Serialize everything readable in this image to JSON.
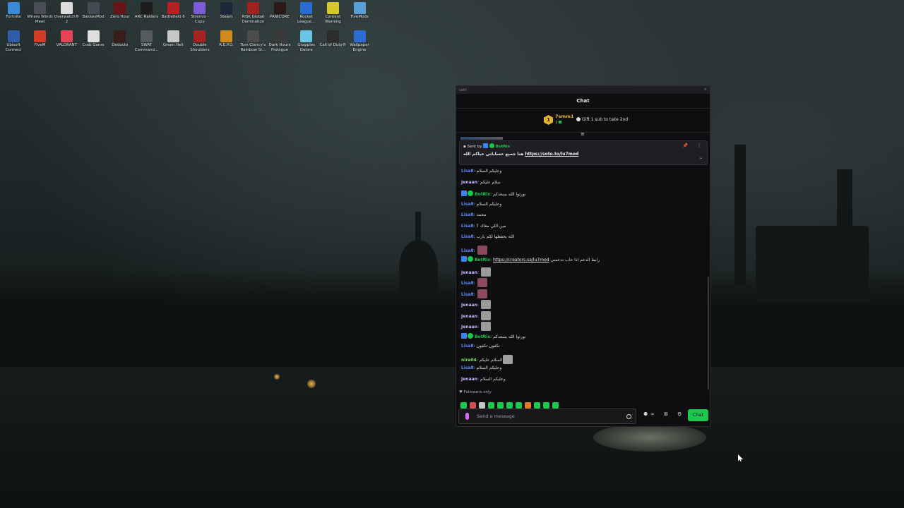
{
  "desktop": {
    "icons_row1": [
      {
        "label": "Fortnite",
        "color": "#3b8ad8"
      },
      {
        "label": "Where Winds Meet",
        "color": "#4a4f55"
      },
      {
        "label": "Overwatch® 2",
        "color": "#dcdcdc"
      },
      {
        "label": "BakkesMod",
        "color": "#444a52"
      },
      {
        "label": "Zero Hour",
        "color": "#6a1515"
      },
      {
        "label": "ARC Raiders",
        "color": "#1c1c1c"
      },
      {
        "label": "Battlefield 6",
        "color": "#b81f25"
      },
      {
        "label": "Stremio - Copy",
        "color": "#7b5bd6"
      },
      {
        "label": "Steam",
        "color": "#1b2838"
      },
      {
        "label": "RISK Global Domination",
        "color": "#a32020"
      },
      {
        "label": "PANICORE",
        "color": "#2a1a1a"
      },
      {
        "label": "Rocket League...",
        "color": "#2a6bd1"
      },
      {
        "label": "Content Warning",
        "color": "#d7c62e"
      },
      {
        "label": "FiveMods",
        "color": "#5aa0d6"
      }
    ],
    "icons_row2": [
      {
        "label": "Ubisoft Connect",
        "color": "#2f5da8"
      },
      {
        "label": "FiveM",
        "color": "#d43c24"
      },
      {
        "label": "VALORANT",
        "color": "#e84455"
      },
      {
        "label": "Crab Game",
        "color": "#dedede"
      },
      {
        "label": "Deducto",
        "color": "#3a1c1c"
      },
      {
        "label": "SWAT Command...",
        "color": "#555a60"
      },
      {
        "label": "Green Hell",
        "color": "#c7c7c7"
      },
      {
        "label": "Double Shoulders",
        "color": "#a92222"
      },
      {
        "label": "R.E.P.O.",
        "color": "#d08a1e"
      },
      {
        "label": "Tom Clancy's Rainbow Si...",
        "color": "#4d4d4d"
      },
      {
        "label": "Dark Hours Prologue",
        "color": "#3a3a3a"
      },
      {
        "label": "Grapples Galore",
        "color": "#6ac2e5"
      },
      {
        "label": "Call of Duty®",
        "color": "#2c2c2c"
      },
      {
        "label": "Wallpaper Engine",
        "color": "#2d6ad1"
      }
    ]
  },
  "chat_window": {
    "title": "cah!",
    "close": "×",
    "header": "Chat",
    "leader": {
      "rank": "1",
      "username": "7smm1",
      "count": "1",
      "gift_text": "Gift 1 sub to take 2nd"
    },
    "collapse_icon": "≡",
    "pinned": {
      "sent_by": "Sent by",
      "bot_name": "BotRix",
      "message": "هنا جميع حساباتي حياكم الله",
      "link": "https://soto.to/lu7mod",
      "pin_icon": "📌",
      "more_icon": "⋮",
      "expand_icon": "⌄"
    },
    "messages": [
      {
        "user": "Lisa8",
        "text": "وعليكم السلام",
        "cls": "u-lisa",
        "badges": false,
        "emotes": 0,
        "link": ""
      },
      {
        "user": "Jenaan",
        "text": "سلام عليكم",
        "cls": "u-jen",
        "badges": false,
        "emotes": 0,
        "link": ""
      },
      {
        "user": "BotRix",
        "text": "نورتوا الله يسعدكم",
        "cls": "u-bot",
        "badges": true,
        "emotes": 0,
        "link": ""
      },
      {
        "user": "Lisa8",
        "text": "وعليكم السلام",
        "cls": "u-lisa",
        "badges": false,
        "emotes": 0,
        "link": ""
      },
      {
        "user": "Lisa8",
        "text": "محمد",
        "cls": "u-lisa",
        "badges": false,
        "emotes": 0,
        "link": ""
      },
      {
        "user": "Lisa8",
        "text": "مين اللي معاك ؟",
        "cls": "u-lisa",
        "badges": false,
        "emotes": 0,
        "link": ""
      },
      {
        "user": "Lisa8",
        "text": "الله يحفظها لكم يارب",
        "cls": "u-lisa",
        "badges": false,
        "emotes": 0,
        "link": ""
      },
      {
        "user": "Lisa8",
        "text": "",
        "cls": "u-lisa",
        "badges": false,
        "emotes": 1,
        "emote_color": "#8a4a5e",
        "link": ""
      },
      {
        "user": "BotRix",
        "text": "رابط الدعم اذا حاب تدعمني",
        "cls": "u-bot",
        "badges": true,
        "emotes": 0,
        "link": "https://creators.sa/lu7mod"
      },
      {
        "user": "Jenaan",
        "text": "",
        "cls": "u-jen",
        "badges": false,
        "emotes": 1,
        "emote_color": "#9a9a9a",
        "link": ""
      },
      {
        "user": "Lisa8",
        "text": "",
        "cls": "u-lisa",
        "badges": false,
        "emotes": 1,
        "emote_color": "#8a4a5e",
        "link": ""
      },
      {
        "user": "Lisa8",
        "text": "",
        "cls": "u-lisa",
        "badges": false,
        "emotes": 1,
        "emote_color": "#8a4a5e",
        "link": ""
      },
      {
        "user": "Jenaan",
        "text": "",
        "cls": "u-jen",
        "badges": false,
        "emotes": 1,
        "emote_color": "#9a9a9a",
        "link": ""
      },
      {
        "user": "Jenaan",
        "text": "",
        "cls": "u-jen",
        "badges": false,
        "emotes": 1,
        "emote_color": "#9a9a9a",
        "link": ""
      },
      {
        "user": "Jenaan",
        "text": "",
        "cls": "u-jen",
        "badges": false,
        "emotes": 1,
        "emote_color": "#9a9a9a",
        "link": ""
      },
      {
        "user": "BotRix",
        "text": "نورتوا الله يسعدكم",
        "cls": "u-bot",
        "badges": true,
        "emotes": 0,
        "link": ""
      },
      {
        "user": "Lisa8",
        "text": "تكفون تكفون",
        "cls": "u-lisa",
        "badges": false,
        "emotes": 0,
        "link": ""
      },
      {
        "user": "nira04",
        "text": "السلام عليكم",
        "cls": "u-nira",
        "badges": false,
        "emotes": 1,
        "emote_color": "#a0a0a0",
        "link": ""
      },
      {
        "user": "Lisa8",
        "text": "وعليكم السلام",
        "cls": "u-lisa",
        "badges": false,
        "emotes": 0,
        "link": ""
      },
      {
        "user": "Jenaan",
        "text": "وعليكم السلام",
        "cls": "u-jen",
        "badges": false,
        "emotes": 0,
        "link": ""
      }
    ],
    "followers_only": "♥ Followers only",
    "emote_bar": [
      "#1bc74c",
      "#d05050",
      "#c8c8c8",
      "#1bc74c",
      "#1bc74c",
      "#1bc74c",
      "#1bc74c",
      "#e07a2f",
      "#1bc74c",
      "#1bc74c",
      "#1bc74c"
    ],
    "input": {
      "placeholder": "Send a message",
      "chat_button": "Chat"
    },
    "toolbar_icons": {
      "users": "⚉",
      "infinity": "∞",
      "gift": "⊞",
      "settings": "⚙"
    }
  }
}
